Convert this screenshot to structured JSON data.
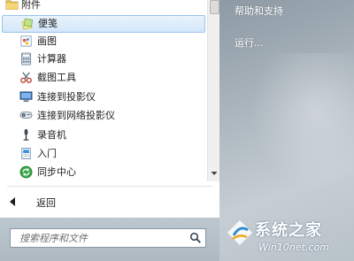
{
  "menu": {
    "items": [
      {
        "label": "附件",
        "icon": "folder-icon",
        "type": "folder"
      },
      {
        "label": "便笺",
        "icon": "sticky-notes-icon",
        "type": "selected"
      },
      {
        "label": "画图",
        "icon": "paint-icon",
        "type": "item"
      },
      {
        "label": "计算器",
        "icon": "calculator-icon",
        "type": "item"
      },
      {
        "label": "截图工具",
        "icon": "snipping-tool-icon",
        "type": "item"
      },
      {
        "label": "连接到投影仪",
        "icon": "projector-icon",
        "type": "item"
      },
      {
        "label": "连接到网络投影仪",
        "icon": "network-projector-icon",
        "type": "item"
      },
      {
        "label": "录音机",
        "icon": "microphone-icon",
        "type": "item"
      },
      {
        "label": "入门",
        "icon": "getting-started-icon",
        "type": "item"
      },
      {
        "label": "同步中心",
        "icon": "sync-center-icon",
        "type": "item"
      }
    ],
    "back_label": "返回"
  },
  "search": {
    "placeholder": "搜索程序和文件"
  },
  "right": {
    "help_label": "帮助和支持",
    "run_label": "运行..."
  },
  "watermark": {
    "title": "系统之家",
    "url": "Win10net.com"
  }
}
